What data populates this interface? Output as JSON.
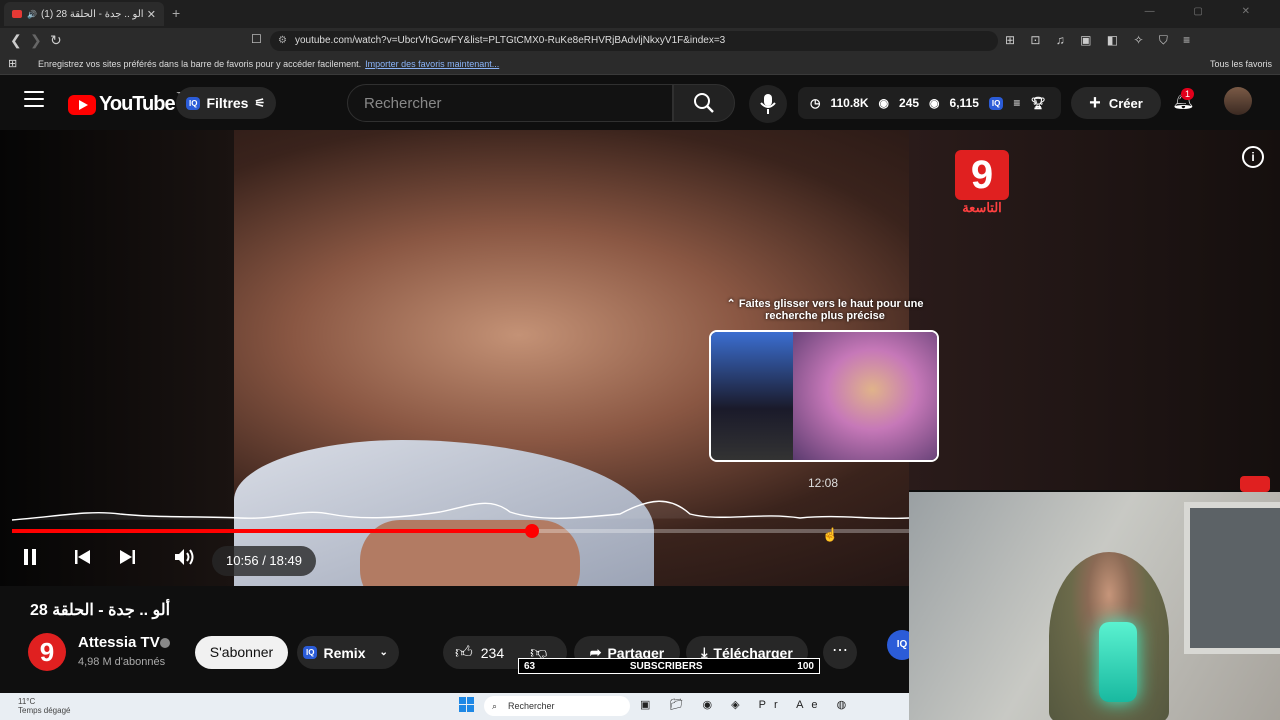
{
  "browser": {
    "tab_title": "(1) ألو .. جدة - الحلقة 28 - YouTube",
    "url": "youtube.com/watch?v=UbcrVhGcwFY&list=PLTGtCMX0-RuKe8eRHVRjBAdvljNkxyV1F&index=3",
    "bookmarks_msg": "Enregistrez vos sites préférés dans la barre de favoris pour y accéder facilement.",
    "bookmarks_link": "Importer des favoris maintenant...",
    "all_favorites": "Tous les favoris"
  },
  "header": {
    "logo": "YouTube",
    "logo_country": "TN",
    "filters_label": "Filtres",
    "iq_badge": "IQ",
    "search_placeholder": "Rechercher",
    "stats": {
      "time": "110.8K",
      "views_a": "245",
      "views_b": "6,115"
    },
    "create_label": "Créer",
    "notif_count": "1"
  },
  "player": {
    "channel_logo_digit": "9",
    "channel_logo_text": "التاسعة",
    "hint": "⌃ Faites glisser vers le haut pour une recherche plus précise",
    "preview_time": "12:08",
    "current_time": "10:56 / 18:49",
    "progress": 0.58
  },
  "video": {
    "title": "ألو .. جدة - الحلقة 28",
    "channel_name": "Attessia TV",
    "channel_subs": "4,98 M d'abonnés",
    "subscribe_label": "S'abonner",
    "remix_label": "Remix",
    "likes": "234",
    "share_label": "Partager",
    "download_label": "Télécharger"
  },
  "sub_counter": {
    "current": "63",
    "label": "SUBSCRIBERS",
    "goal": "100"
  },
  "taskbar": {
    "temp": "11°C",
    "weather": "Temps dégagé",
    "search_label": "Rechercher"
  }
}
